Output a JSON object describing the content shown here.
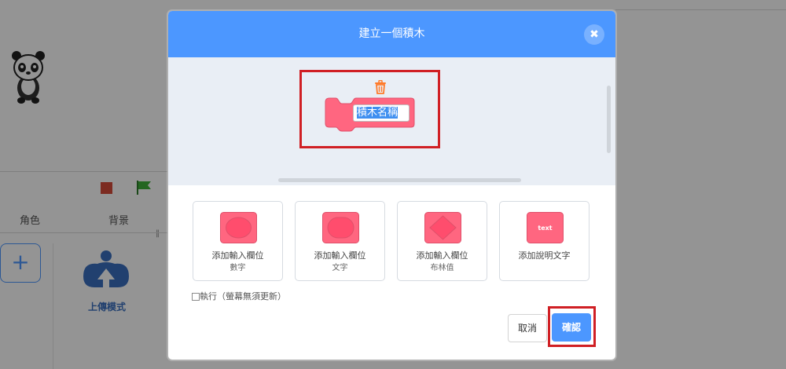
{
  "background": {
    "tabs": {
      "sprites": "角色",
      "backdrops": "背景"
    },
    "add_button": "+",
    "upload_label": "上傳模式"
  },
  "dialog": {
    "title": "建立一個積木",
    "close_icon": "close-icon",
    "block_name": "積木名稱",
    "block_color": "#ff6680",
    "accent_color": "#4c97ff",
    "highlight_color": "#d01f24",
    "options": [
      {
        "label": "添加輸入欄位",
        "sublabel": "數字",
        "icon": "number-input-icon"
      },
      {
        "label": "添加輸入欄位",
        "sublabel": "文字",
        "icon": "text-input-icon"
      },
      {
        "label": "添加輸入欄位",
        "sublabel": "布林值",
        "icon": "boolean-input-icon"
      },
      {
        "label": "添加說明文字",
        "sublabel": "",
        "icon": "label-text-icon",
        "icon_text": "text"
      }
    ],
    "run_without_refresh": {
      "label": "執行（螢幕無須更新）",
      "checked": false
    },
    "cancel_label": "取消",
    "ok_label": "確認"
  }
}
